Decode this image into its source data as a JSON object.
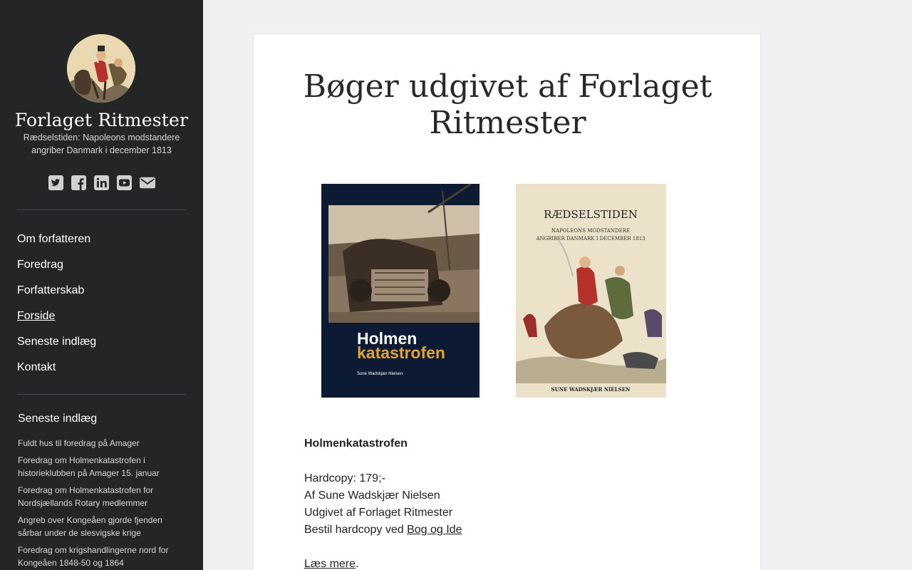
{
  "site": {
    "title": "Forlaget Ritmester",
    "description": "Rædselstiden: Napoleons modstandere angriber Danmark i december 1813"
  },
  "social": [
    {
      "name": "twitter-icon"
    },
    {
      "name": "facebook-icon"
    },
    {
      "name": "linkedin-icon"
    },
    {
      "name": "youtube-icon"
    },
    {
      "name": "email-icon"
    }
  ],
  "nav": {
    "items": [
      {
        "label": "Om forfatteren"
      },
      {
        "label": "Foredrag"
      },
      {
        "label": "Forfatterskab"
      },
      {
        "label": "Forside",
        "current": true
      },
      {
        "label": "Seneste indlæg"
      },
      {
        "label": "Kontakt"
      }
    ]
  },
  "recent": {
    "title": "Seneste indlæg",
    "posts": [
      "Fuldt hus til foredrag på Amager",
      "Foredrag om Holmenkatastrofen i historieklubben på Amager 15. januar",
      "Foredrag om Holmenkatastrofen for Nordsjællands Rotary medlemmer",
      "Angreb over Kongeåen gjorde fjenden sårbar under de slesvigske krige",
      "Foredrag om krigshandlingerne nord for Kongeåen 1848-50 og 1864"
    ]
  },
  "page": {
    "title": "Bøger udgivet af Forlaget Ritmester"
  },
  "books": {
    "cover1": {
      "title_line1": "Holmen",
      "title_line2": "katastrofen",
      "author": "Sune Wadskjær Nielsen"
    },
    "cover2": {
      "title": "RÆDSELSTIDEN",
      "subtitle_line1": "NAPOLEONS MODSTANDERE",
      "subtitle_line2": "ANGRIBER DANMARK I DECEMBER 1813",
      "author": "SUNE WADSKJÆR NIELSEN"
    }
  },
  "book": {
    "heading": "Holmenkatastrofen",
    "price": "Hardcopy: 179;-",
    "author": "Af Sune Wadskjær Nielsen",
    "publisher": "Udgivet af Forlaget Ritmester",
    "order_prefix": "Bestil hardcopy ved ",
    "order_link": "Bog og Ide",
    "read_more": "Læs mere",
    "read_more_suffix": "."
  },
  "colors": {
    "sidebar": "#242527",
    "background": "#eff0f2",
    "card": "#ffffff",
    "cover1_bg": "#0c1a33",
    "cover1_accent": "#e0a52a"
  }
}
